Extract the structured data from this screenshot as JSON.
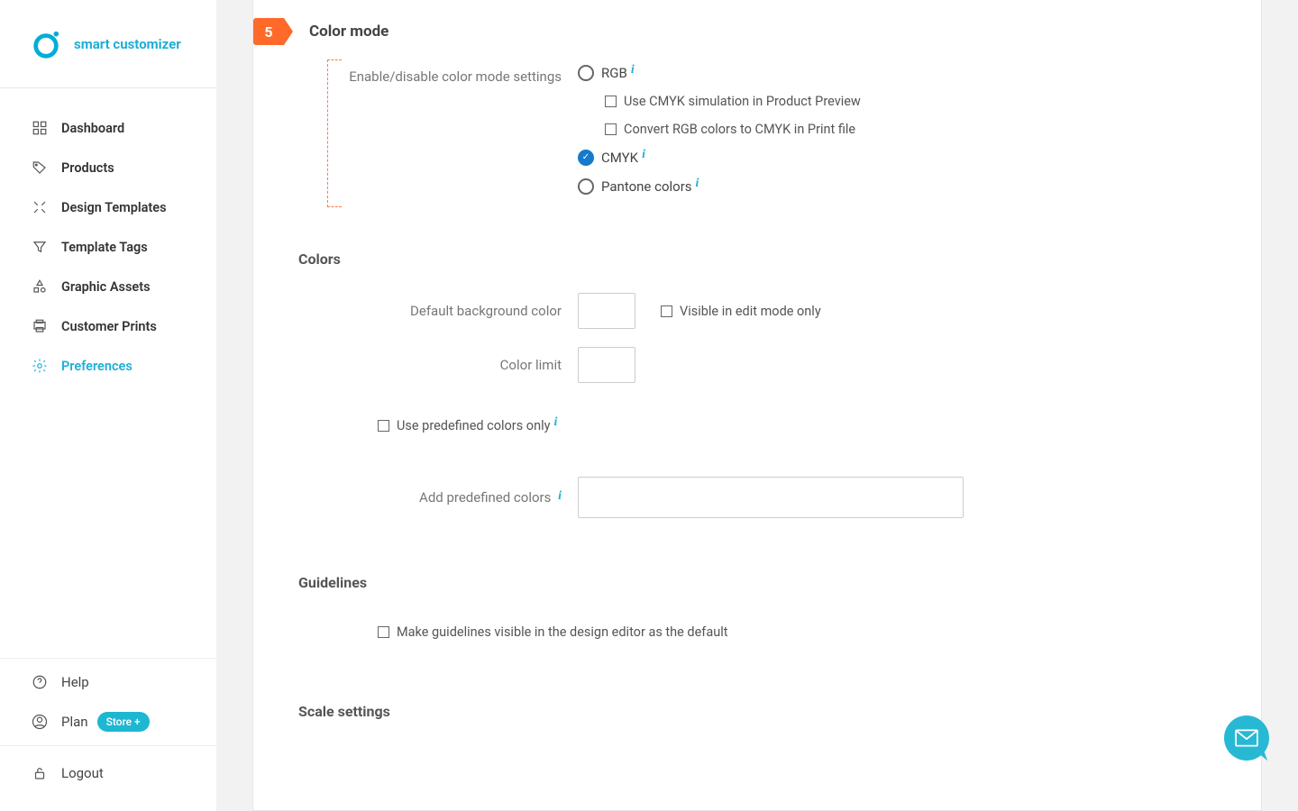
{
  "brand": "smart customizer",
  "sidebar": {
    "items": [
      {
        "label": "Dashboard"
      },
      {
        "label": "Products"
      },
      {
        "label": "Design Templates"
      },
      {
        "label": "Template Tags"
      },
      {
        "label": "Graphic Assets"
      },
      {
        "label": "Customer Prints"
      },
      {
        "label": "Preferences"
      }
    ],
    "help": "Help",
    "plan": "Plan",
    "plan_badge": "Store +",
    "logout": "Logout"
  },
  "section": {
    "step_number": "5",
    "title": "Color mode",
    "enable_label": "Enable/disable color mode settings",
    "opts": {
      "rgb": "RGB",
      "rgb_sub1": "Use CMYK simulation in Product Preview",
      "rgb_sub2": "Convert RGB colors to CMYK in Print file",
      "cmyk": "CMYK",
      "pantone": "Pantone colors"
    }
  },
  "colors": {
    "heading": "Colors",
    "default_bg": "Default background color",
    "visible_edit": "Visible in edit mode only",
    "color_limit": "Color limit",
    "use_predefined": "Use predefined colors only",
    "add_predefined": "Add predefined colors"
  },
  "guidelines": {
    "heading": "Guidelines",
    "make_visible": "Make guidelines visible in the design editor as the default"
  },
  "scale": {
    "heading": "Scale settings"
  }
}
